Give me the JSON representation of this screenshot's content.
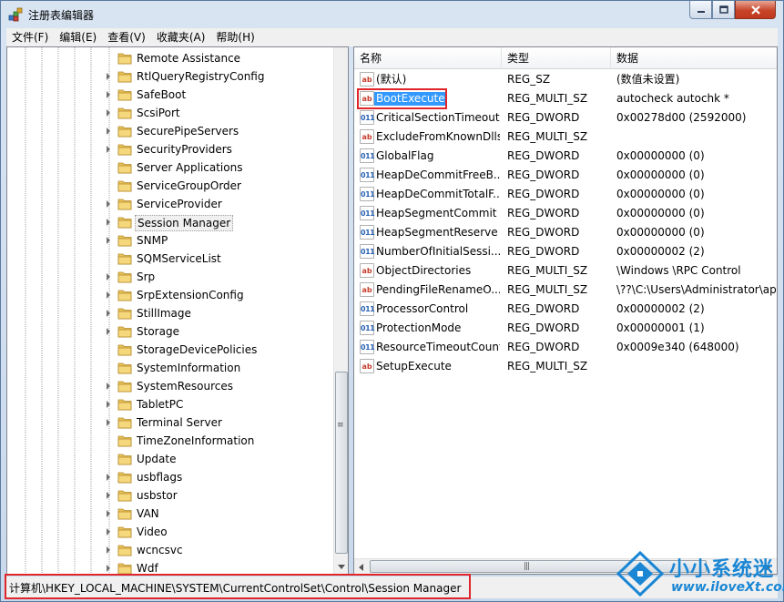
{
  "window": {
    "title": "注册表编辑器"
  },
  "menu": [
    "文件(F)",
    "编辑(E)",
    "查看(V)",
    "收藏夹(A)",
    "帮助(H)"
  ],
  "tree": {
    "items": [
      {
        "label": "Remote Assistance",
        "expandable": false
      },
      {
        "label": "RtlQueryRegistryConfig",
        "expandable": true
      },
      {
        "label": "SafeBoot",
        "expandable": true
      },
      {
        "label": "ScsiPort",
        "expandable": true
      },
      {
        "label": "SecurePipeServers",
        "expandable": true
      },
      {
        "label": "SecurityProviders",
        "expandable": true
      },
      {
        "label": "Server Applications",
        "expandable": false
      },
      {
        "label": "ServiceGroupOrder",
        "expandable": false
      },
      {
        "label": "ServiceProvider",
        "expandable": true
      },
      {
        "label": "Session Manager",
        "expandable": true,
        "selected": true
      },
      {
        "label": "SNMP",
        "expandable": true
      },
      {
        "label": "SQMServiceList",
        "expandable": false
      },
      {
        "label": "Srp",
        "expandable": true
      },
      {
        "label": "SrpExtensionConfig",
        "expandable": true
      },
      {
        "label": "StillImage",
        "expandable": true
      },
      {
        "label": "Storage",
        "expandable": true
      },
      {
        "label": "StorageDevicePolicies",
        "expandable": false
      },
      {
        "label": "SystemInformation",
        "expandable": false
      },
      {
        "label": "SystemResources",
        "expandable": true
      },
      {
        "label": "TabletPC",
        "expandable": true
      },
      {
        "label": "Terminal Server",
        "expandable": true
      },
      {
        "label": "TimeZoneInformation",
        "expandable": false
      },
      {
        "label": "Update",
        "expandable": false
      },
      {
        "label": "usbflags",
        "expandable": true
      },
      {
        "label": "usbstor",
        "expandable": true
      },
      {
        "label": "VAN",
        "expandable": true
      },
      {
        "label": "Video",
        "expandable": true
      },
      {
        "label": "wcncsvc",
        "expandable": true
      },
      {
        "label": "Wdf",
        "expandable": true
      }
    ]
  },
  "list": {
    "columns": {
      "name": "名称",
      "type": "类型",
      "data": "数据"
    },
    "rows": [
      {
        "icon": "ab",
        "kind": "sz",
        "name": "(默认)",
        "type": "REG_SZ",
        "data": "(数值未设置)"
      },
      {
        "icon": "ab",
        "kind": "sz",
        "name": "BootExecute",
        "type": "REG_MULTI_SZ",
        "data": "autocheck autochk *",
        "selected": true
      },
      {
        "icon": "011",
        "kind": "bin",
        "name": "CriticalSectionTimeout",
        "type": "REG_DWORD",
        "data": "0x00278d00 (2592000)"
      },
      {
        "icon": "ab",
        "kind": "sz",
        "name": "ExcludeFromKnownDlls",
        "type": "REG_MULTI_SZ",
        "data": ""
      },
      {
        "icon": "011",
        "kind": "bin",
        "name": "GlobalFlag",
        "type": "REG_DWORD",
        "data": "0x00000000 (0)"
      },
      {
        "icon": "011",
        "kind": "bin",
        "name": "HeapDeCommitFreeB...",
        "type": "REG_DWORD",
        "data": "0x00000000 (0)"
      },
      {
        "icon": "011",
        "kind": "bin",
        "name": "HeapDeCommitTotalF...",
        "type": "REG_DWORD",
        "data": "0x00000000 (0)"
      },
      {
        "icon": "011",
        "kind": "bin",
        "name": "HeapSegmentCommit",
        "type": "REG_DWORD",
        "data": "0x00000000 (0)"
      },
      {
        "icon": "011",
        "kind": "bin",
        "name": "HeapSegmentReserve",
        "type": "REG_DWORD",
        "data": "0x00000000 (0)"
      },
      {
        "icon": "011",
        "kind": "bin",
        "name": "NumberOfInitialSessi...",
        "type": "REG_DWORD",
        "data": "0x00000002 (2)"
      },
      {
        "icon": "ab",
        "kind": "sz",
        "name": "ObjectDirectories",
        "type": "REG_MULTI_SZ",
        "data": "\\Windows \\RPC Control"
      },
      {
        "icon": "ab",
        "kind": "sz",
        "name": "PendingFileRenameO...",
        "type": "REG_MULTI_SZ",
        "data": "\\??\\C:\\Users\\Administrator\\ap"
      },
      {
        "icon": "011",
        "kind": "bin",
        "name": "ProcessorControl",
        "type": "REG_DWORD",
        "data": "0x00000002 (2)"
      },
      {
        "icon": "011",
        "kind": "bin",
        "name": "ProtectionMode",
        "type": "REG_DWORD",
        "data": "0x00000001 (1)"
      },
      {
        "icon": "011",
        "kind": "bin",
        "name": "ResourceTimeoutCount",
        "type": "REG_DWORD",
        "data": "0x0009e340 (648000)"
      },
      {
        "icon": "ab",
        "kind": "sz",
        "name": "SetupExecute",
        "type": "REG_MULTI_SZ",
        "data": ""
      }
    ]
  },
  "status": {
    "path": "计算机\\HKEY_LOCAL_MACHINE\\SYSTEM\\CurrentControlSet\\Control\\Session Manager"
  },
  "watermark": {
    "brand": "小小系统迷",
    "url": "www.iloveXt.com"
  },
  "colors": {
    "selection": "#3399ff",
    "highlight_box": "#e0262a",
    "watermark": "#1a86d4"
  }
}
